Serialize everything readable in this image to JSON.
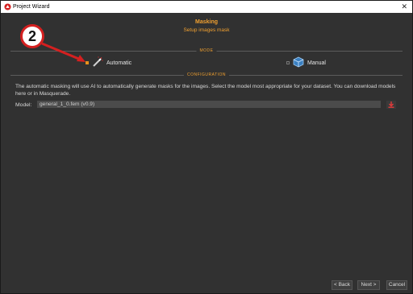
{
  "window": {
    "title": "Project Wizard"
  },
  "header": {
    "title": "Masking",
    "subtitle": "Setup images mask"
  },
  "sections": {
    "mode": "MODE",
    "configuration": "CONFIGURATION"
  },
  "modes": [
    {
      "label": "Automatic",
      "selected": true
    },
    {
      "label": "Manual",
      "selected": false
    }
  ],
  "configuration": {
    "description": "The automatic masking will use AI to automatically generate masks for the images. Select the model most appropriate for your dataset. You can download models here or in Masquerade.",
    "model_label": "Model:",
    "model_value": "general_1_0.fem (v0.9)"
  },
  "footer": {
    "back": "< Back",
    "next": "Next >",
    "cancel": "Cancel"
  },
  "annotation": {
    "step_number": "2"
  },
  "colors": {
    "accent": "#f0a030",
    "annotation": "#d42020",
    "background": "#313131"
  },
  "icons": {
    "close": "close-icon",
    "app": "app-logo-icon",
    "automatic": "magic-wand-icon",
    "manual": "cube-icon",
    "download": "download-icon"
  }
}
